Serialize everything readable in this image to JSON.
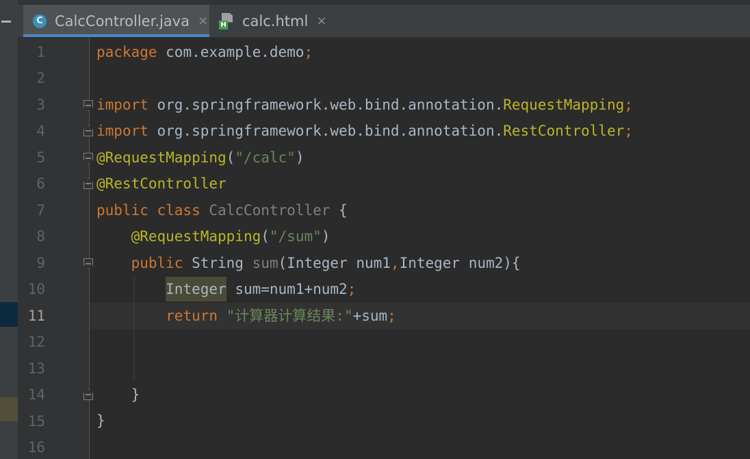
{
  "tabs": [
    {
      "label": "CalcController.java",
      "icon": "java-class-icon",
      "active": true
    },
    {
      "label": "calc.html",
      "icon": "html-file-icon",
      "active": false
    }
  ],
  "tab_close_glyph": "×",
  "line_numbers": [
    "1",
    "2",
    "3",
    "4",
    "5",
    "6",
    "7",
    "8",
    "9",
    "10",
    "11",
    "12",
    "13",
    "14",
    "15",
    "16"
  ],
  "current_line": "11",
  "code": {
    "l1": {
      "kw": "package",
      "rest": " com.example.demo",
      "semi": ";"
    },
    "l3": {
      "kw": "import",
      "pkg": " org.springframework.web.bind.annotation.",
      "cls": "RequestMapping",
      "semi": ";"
    },
    "l4": {
      "kw": "import",
      "pkg": " org.springframework.web.bind.annotation.",
      "cls": "RestController",
      "semi": ";"
    },
    "l5": {
      "ann": "@RequestMapping",
      "open": "(",
      "str": "\"/calc\"",
      "close": ")"
    },
    "l6": {
      "ann": "@RestController"
    },
    "l7": {
      "kw1": "public",
      "kw2": " class",
      "name": " CalcController",
      "brace": " {"
    },
    "l8": {
      "ann": "@RequestMapping",
      "open": "(",
      "str": "\"/sum\"",
      "close": ")"
    },
    "l9": {
      "kw": "public",
      "type": " String",
      "method": " sum",
      "params": "(Integer num1",
      "comma": ",",
      "params2": "Integer num2){"
    },
    "l10": {
      "type": "Integer",
      "rest": " sum=num1+num2",
      "semi": ";"
    },
    "l11": {
      "kw": "return",
      "str": " \"计算器计算结果:\"",
      "rest": "+sum",
      "semi": ";"
    },
    "l14": {
      "brace": "}"
    },
    "l15": {
      "brace": "}"
    }
  },
  "colors": {
    "background": "#2b2b2b",
    "keyword": "#cc7832",
    "annotation": "#bbb529",
    "string": "#6a8759",
    "plain": "#a9b7c6",
    "active_tab_underline": "#4a88c7"
  }
}
